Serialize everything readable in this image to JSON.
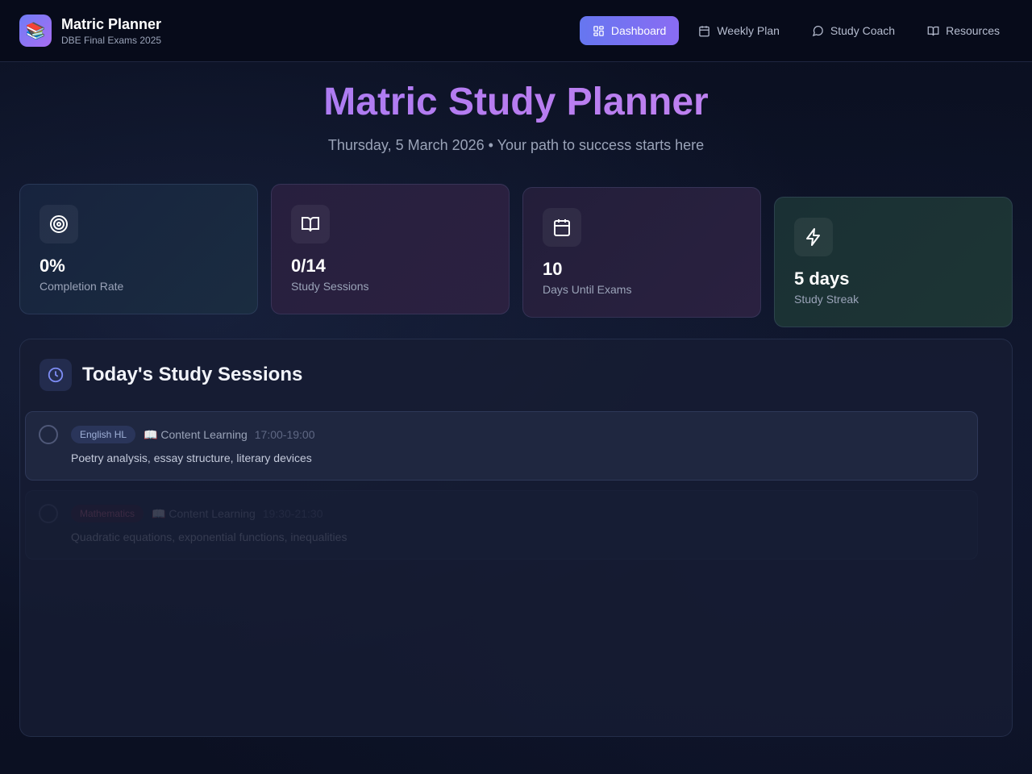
{
  "app": {
    "logo_glyph": "📚",
    "title": "Matric Planner",
    "subtitle": "DBE Final Exams 2025"
  },
  "nav": {
    "items": [
      {
        "label": "Dashboard",
        "icon": "grid-icon",
        "active": true
      },
      {
        "label": "Weekly Plan",
        "icon": "calendar-icon",
        "active": false
      },
      {
        "label": "Study Coach",
        "icon": "chat-icon",
        "active": false
      },
      {
        "label": "Resources",
        "icon": "book-open-icon",
        "active": false
      }
    ]
  },
  "hero": {
    "title": "Matric Study Planner",
    "subtitle": "Thursday, 5 March 2026 • Your path to success starts here"
  },
  "stats": [
    {
      "value": "0%",
      "label": "Completion Rate",
      "icon": "target-icon"
    },
    {
      "value": "0/14",
      "label": "Study Sessions",
      "icon": "book-open-icon"
    },
    {
      "value": "10",
      "label": "Days Until Exams",
      "icon": "calendar-icon"
    },
    {
      "value": "5 days",
      "label": "Study Streak",
      "icon": "lightning-icon"
    }
  ],
  "sessions_panel": {
    "title": "Today's Study Sessions",
    "icon": "clock-icon",
    "sessions": [
      {
        "subject": "English HL",
        "type": "📖 Content Learning",
        "time": "17:00-19:00",
        "description": "Poetry analysis, essay structure, literary devices",
        "completed": false
      },
      {
        "subject": "Mathematics",
        "type": "📖 Content Learning",
        "time": "19:30-21:30",
        "description": "Quadratic equations, exponential functions, inequalities",
        "completed": false
      }
    ]
  },
  "colors": {
    "accent": "#6676f0",
    "accent_purple": "#8a6cf3",
    "background": "#0b1022"
  }
}
